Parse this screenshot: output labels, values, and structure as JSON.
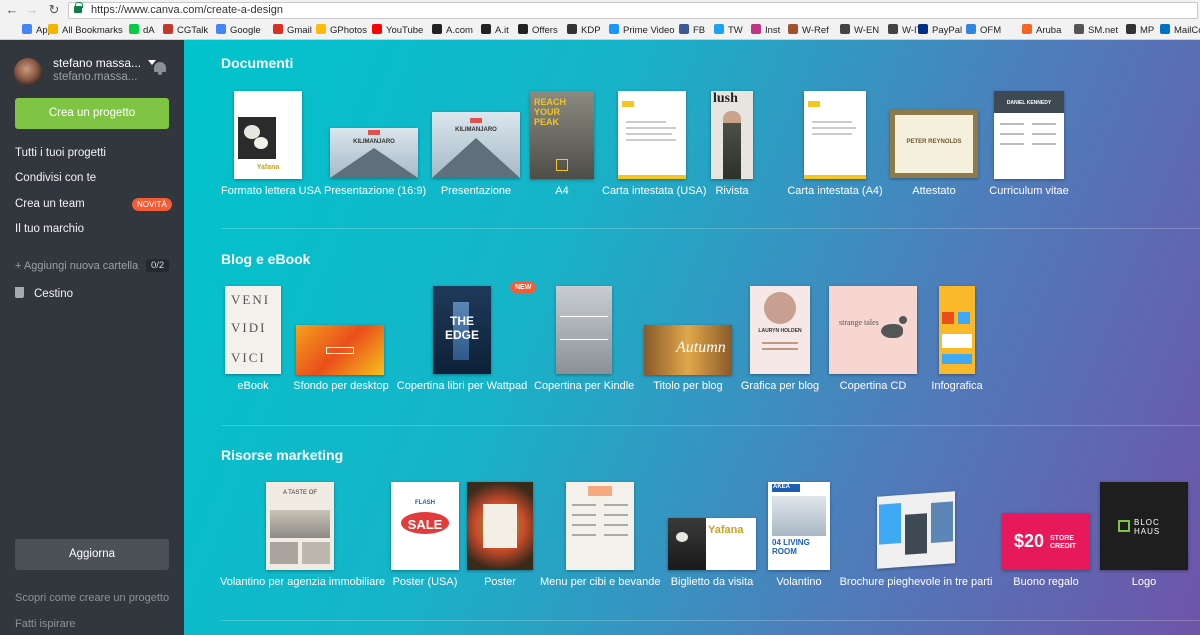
{
  "browser": {
    "url": "https://www.canva.com/create-a-design",
    "bookmarks": [
      {
        "label": "App",
        "icon": "apps-icon",
        "color": "#4285f4"
      },
      {
        "label": "All Bookmarks",
        "icon": "folder-icon",
        "color": "#f4b400"
      },
      {
        "label": "dA",
        "icon": "deviantart-icon",
        "color": "#05cc47"
      },
      {
        "label": "CGTalk",
        "icon": "cgtalk-icon",
        "color": "#c0392b"
      },
      {
        "label": "Google",
        "icon": "google-icon",
        "color": "#4285f4"
      },
      {
        "label": "Gmail",
        "icon": "gmail-icon",
        "color": "#d93025"
      },
      {
        "label": "GPhotos",
        "icon": "photos-icon",
        "color": "#fbbc05"
      },
      {
        "label": "YouTube",
        "icon": "youtube-icon",
        "color": "#ff0000"
      },
      {
        "label": "A.com",
        "icon": "amazon-icon",
        "color": "#222222"
      },
      {
        "label": "A.it",
        "icon": "amazon-icon",
        "color": "#222222"
      },
      {
        "label": "Offers",
        "icon": "amazon-icon",
        "color": "#222222"
      },
      {
        "label": "KDP",
        "icon": "kdp-icon",
        "color": "#333333"
      },
      {
        "label": "Prime Video",
        "icon": "primevideo-icon",
        "color": "#1a98ff"
      },
      {
        "label": "FB",
        "icon": "facebook-icon",
        "color": "#3b5998"
      },
      {
        "label": "TW",
        "icon": "twitter-icon",
        "color": "#1da1f2"
      },
      {
        "label": "Inst",
        "icon": "instagram-icon",
        "color": "#c13584"
      },
      {
        "label": "W-Ref",
        "icon": "wordref-icon",
        "color": "#a0522d"
      },
      {
        "label": "W-EN",
        "icon": "wikipedia-icon",
        "color": "#444444"
      },
      {
        "label": "W-IT",
        "icon": "wikipedia-icon",
        "color": "#444444"
      },
      {
        "label": "PayPal",
        "icon": "paypal-icon",
        "color": "#003087"
      },
      {
        "label": "OFM",
        "icon": "ofm-icon",
        "color": "#2e86de"
      },
      {
        "label": "Aruba",
        "icon": "aruba-icon",
        "color": "#f26522"
      },
      {
        "label": "SM.net",
        "icon": "smnet-icon",
        "color": "#555555"
      },
      {
        "label": "MP",
        "icon": "mp-icon",
        "color": "#333333"
      },
      {
        "label": "MailCo",
        "icon": "mail-icon",
        "color": "#0072c6"
      }
    ]
  },
  "sidebar": {
    "user_name": "stefano massa...",
    "user_email": "stefano.massa...",
    "create_button": "Crea un progetto",
    "nav": [
      "Tutti i tuoi progetti",
      "Condivisi con te",
      "Crea un team",
      "Il tuo marchio"
    ],
    "badge_new": "NOVITÀ",
    "add_folder": "+ Aggiungi nuova cartella",
    "folder_count": "0/2",
    "trash": "Cestino",
    "upgrade_button": "Aggiorna",
    "footer_links": [
      "Scopri come creare un progetto",
      "Fatti ispirare"
    ]
  },
  "sections": [
    {
      "title": "Documenti",
      "items": [
        "Formato lettera USA",
        "Presentazione (16:9)",
        "Presentazione",
        "A4",
        "Carta intestata (USA)",
        "Rivista",
        "Carta intestata (A4)",
        "Attestato",
        "Curriculum vitae"
      ]
    },
    {
      "title": "Blog e eBook",
      "badge": "NEW",
      "items": [
        "eBook",
        "Sfondo per desktop",
        "Copertina libri per Wattpad",
        "Copertina per Kindle",
        "Titolo per blog",
        "Grafica per blog",
        "Copertina CD",
        "Infografica"
      ]
    },
    {
      "title": "Risorse marketing",
      "items": [
        "Volantino per agenzia immobiliare",
        "Poster (USA)",
        "Poster",
        "Menu per cibi e bevande",
        "Biglietto da visita",
        "Volantino",
        "Brochure pieghevole in tre parti",
        "Buono regalo",
        "Logo"
      ]
    }
  ],
  "thumb_text": {
    "kilimanjaro": "KILIMANJARO",
    "reach": "REACH YOUR PEAK",
    "lush": "lush",
    "attestato_name": "PETER REYNOLDS",
    "cv_name": "DANIEL KENNEDY",
    "veni": "VENI",
    "vidi": "VIDI",
    "vici": "VICI",
    "edge": "THE EDGE",
    "autumn": "Autumn",
    "holden": "LAURYN HOLDEN",
    "strange": "strange tales",
    "sale": "SALE",
    "flash": "FLASH",
    "yafana": "Yafana",
    "living": "04 LIVING ROOM",
    "akea": "AKEA",
    "gift": "$20",
    "gift_sub": "STORE CREDIT",
    "bloc": "BLOC HAUS",
    "taste": "A TASTE OF"
  },
  "colors": {
    "accent_green": "#7fc543",
    "sidebar_bg": "#31373d",
    "badge_red": "#f35d36"
  }
}
